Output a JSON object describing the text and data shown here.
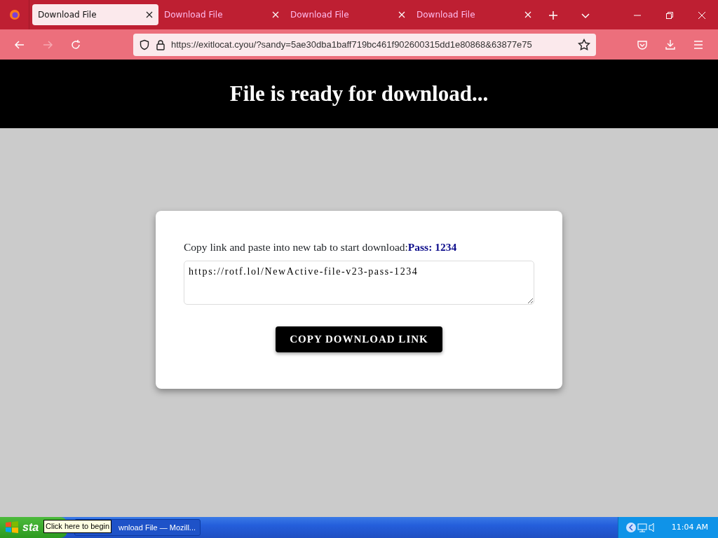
{
  "browser": {
    "tabs": [
      {
        "label": "Download File",
        "selected": true
      },
      {
        "label": "Download File",
        "selected": false
      },
      {
        "label": "Download File",
        "selected": false
      },
      {
        "label": "Download File",
        "selected": false
      }
    ],
    "url": "https://exitlocat.cyou/?sandy=5ae30dba1baff719bc461f902600315dd1e80868&63877e75"
  },
  "page": {
    "heading": "File is ready for download...",
    "message": "Copy link and paste into new tab to start download:**Pass: 1234**",
    "link_value": "https://rotf.lol/NewActive-file-v23-pass-1234",
    "button": "COPY DOWNLOAD LINK"
  },
  "taskbar": {
    "start": "sta",
    "tooltip": "Click here to begin",
    "items": [
      {
        "label": "wnload File — Mozill..."
      }
    ],
    "clock": "11:04 AM"
  }
}
